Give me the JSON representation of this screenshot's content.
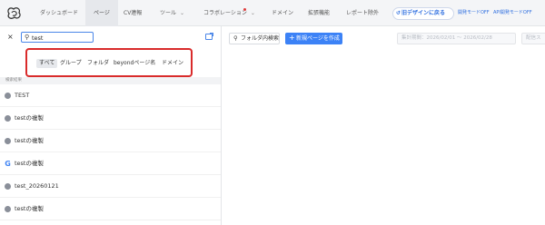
{
  "nav": {
    "items": [
      {
        "label": "ダッシュボード"
      },
      {
        "label": "ページ"
      },
      {
        "label": "CV連報"
      },
      {
        "label": "ツール"
      },
      {
        "label": "コラボレーション"
      },
      {
        "label": "ドメイン"
      },
      {
        "label": "拡張機能"
      },
      {
        "label": "レポート除外"
      }
    ],
    "old_design_label": "旧デザインに戻る",
    "mode_link_1": "開発モードOFF",
    "mode_link_2": "API開発モードOFF",
    "accent_color": "#2f6fe0"
  },
  "left": {
    "search_value": "test",
    "filter_chips": [
      {
        "label": "すべて",
        "active": true
      },
      {
        "label": "グループ"
      },
      {
        "label": "フォルダ"
      },
      {
        "label": "beyondページ名"
      },
      {
        "label": "ドメイン"
      }
    ],
    "results_label": "検索結果",
    "results": [
      {
        "label": "TEST",
        "icon": "page-icon"
      },
      {
        "label": "testの複製",
        "icon": "page-icon"
      },
      {
        "label": "testの複製",
        "icon": "page-icon"
      },
      {
        "label": "testの複製",
        "icon": "google-icon"
      },
      {
        "label": "test_20260121",
        "icon": "page-icon"
      },
      {
        "label": "testの複製",
        "icon": "page-icon"
      }
    ]
  },
  "toolbar": {
    "folder_search_label": "フォルダ内検索",
    "new_page_label": "新規ページを作成",
    "period_label": "集計期間：2026/02/01 〜 2026/02/28",
    "extra_label": "配信ス"
  }
}
